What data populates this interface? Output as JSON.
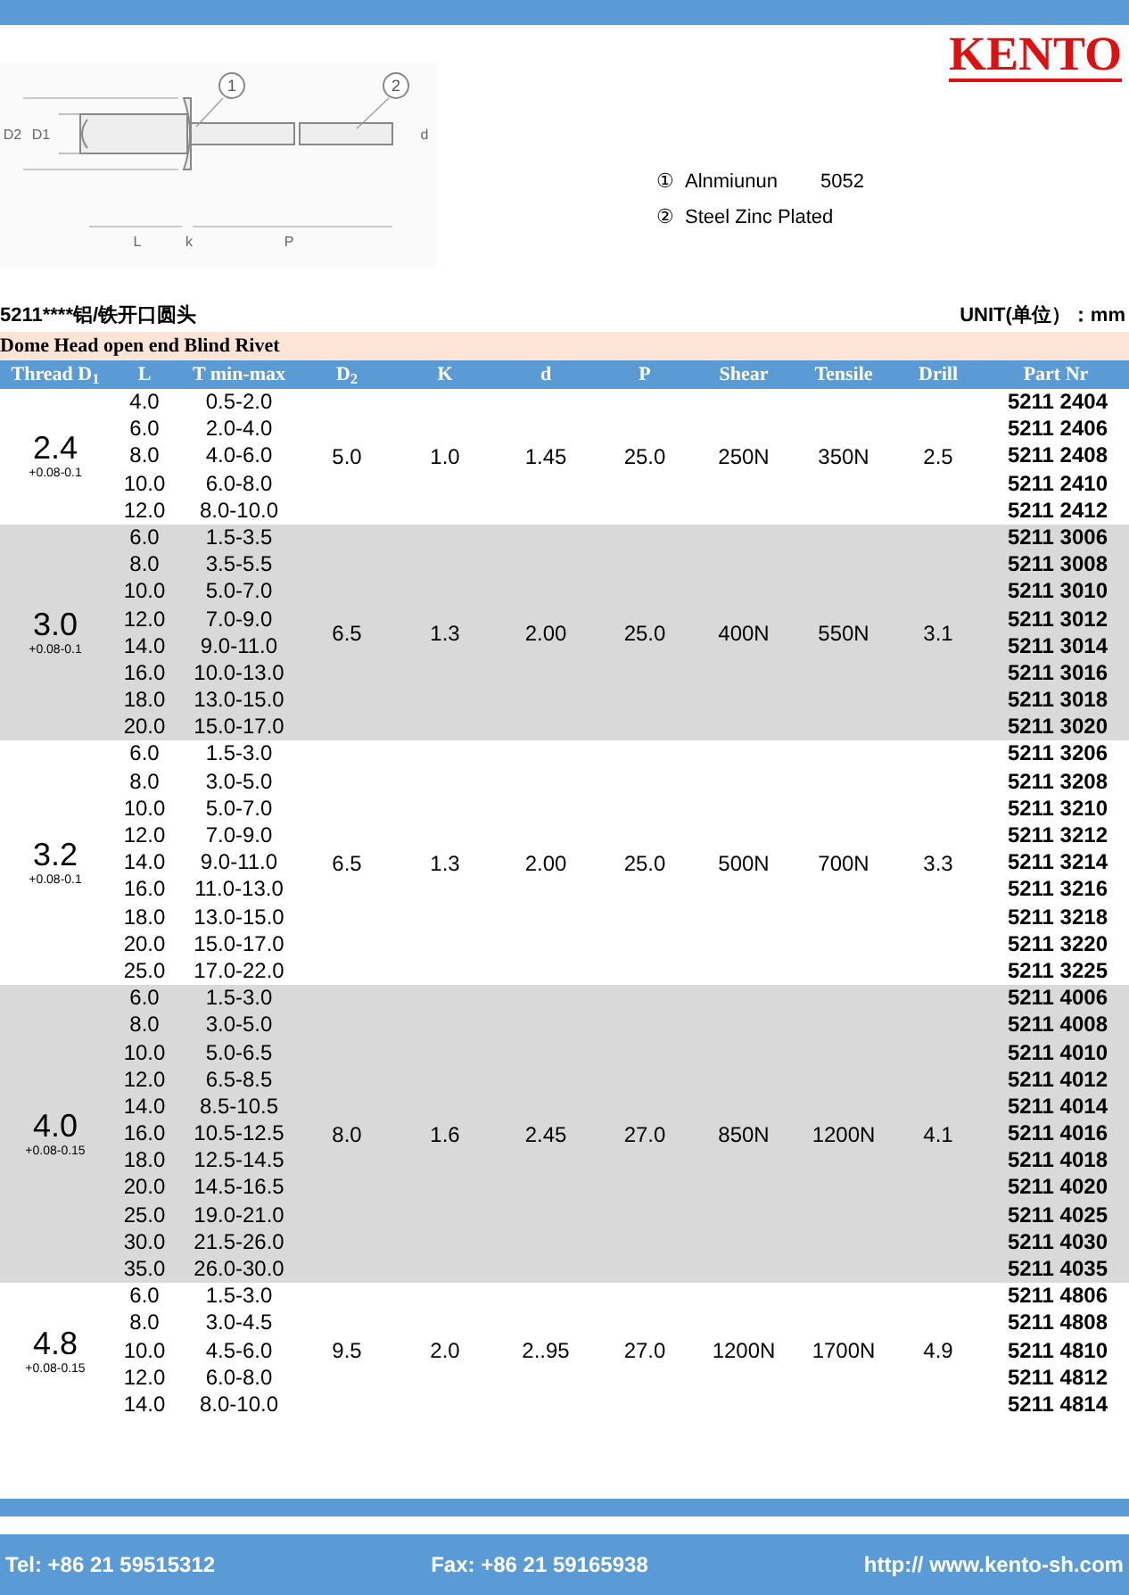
{
  "logo": "KENTO",
  "diagram": {
    "callouts": [
      "1",
      "2"
    ],
    "labels": [
      "D2",
      "D1",
      "d",
      "L",
      "k",
      "P"
    ]
  },
  "legend": [
    {
      "marker": "①",
      "material": "Alnmiunun",
      "grade": "5052"
    },
    {
      "marker": "②",
      "material": "Steel Zinc Plated"
    }
  ],
  "series_name": "5211****铝/铁开口圆头",
  "unit": "UNIT(单位）：mm",
  "table": {
    "title": "Dome Head open end Blind Rivet",
    "columns": [
      "Thread D$_{1}$",
      "L",
      "T min-max",
      "D$_{2}$",
      "K",
      "d",
      "P",
      "Shear",
      "Tensile",
      "Drill",
      "Part Nr"
    ],
    "groups": [
      {
        "shaded": false,
        "thread": "2.4",
        "tolerance": "+0.08-0.1",
        "d2": "5.0",
        "k": "1.0",
        "d": "1.45",
        "p": "25.0",
        "shear": "250N",
        "tensile": "350N",
        "drill": "2.5",
        "rows": [
          {
            "l": "4.0",
            "t": "0.5-2.0",
            "part": "5211 2404"
          },
          {
            "l": "6.0",
            "t": "2.0-4.0",
            "part": "5211 2406"
          },
          {
            "l": "8.0",
            "t": "4.0-6.0",
            "part": "5211 2408"
          },
          {
            "l": "10.0",
            "t": "6.0-8.0",
            "part": "5211 2410"
          },
          {
            "l": "12.0",
            "t": "8.0-10.0",
            "part": "5211 2412"
          }
        ]
      },
      {
        "shaded": true,
        "thread": "3.0",
        "tolerance": "+0.08-0.1",
        "d2": "6.5",
        "k": "1.3",
        "d": "2.00",
        "p": "25.0",
        "shear": "400N",
        "tensile": "550N",
        "drill": "3.1",
        "rows": [
          {
            "l": "6.0",
            "t": "1.5-3.5",
            "part": "5211 3006"
          },
          {
            "l": "8.0",
            "t": "3.5-5.5",
            "part": "5211 3008"
          },
          {
            "l": "10.0",
            "t": "5.0-7.0",
            "part": "5211 3010"
          },
          {
            "l": "12.0",
            "t": "7.0-9.0",
            "part": "5211 3012"
          },
          {
            "l": "14.0",
            "t": "9.0-11.0",
            "part": "5211 3014"
          },
          {
            "l": "16.0",
            "t": "10.0-13.0",
            "part": "5211 3016"
          },
          {
            "l": "18.0",
            "t": "13.0-15.0",
            "part": "5211 3018"
          },
          {
            "l": "20.0",
            "t": "15.0-17.0",
            "part": "5211 3020"
          }
        ]
      },
      {
        "shaded": false,
        "thread": "3.2",
        "tolerance": "+0.08-0.1",
        "d2": "6.5",
        "k": "1.3",
        "d": "2.00",
        "p": "25.0",
        "shear": "500N",
        "tensile": "700N",
        "drill": "3.3",
        "rows": [
          {
            "l": "6.0",
            "t": "1.5-3.0",
            "part": "5211 3206"
          },
          {
            "l": "8.0",
            "t": "3.0-5.0",
            "part": "5211 3208"
          },
          {
            "l": "10.0",
            "t": "5.0-7.0",
            "part": "5211 3210"
          },
          {
            "l": "12.0",
            "t": "7.0-9.0",
            "part": "5211 3212"
          },
          {
            "l": "14.0",
            "t": "9.0-11.0",
            "part": "5211 3214"
          },
          {
            "l": "16.0",
            "t": "11.0-13.0",
            "part": "5211 3216"
          },
          {
            "l": "18.0",
            "t": "13.0-15.0",
            "part": "5211 3218"
          },
          {
            "l": "20.0",
            "t": "15.0-17.0",
            "part": "5211 3220"
          },
          {
            "l": "25.0",
            "t": "17.0-22.0",
            "part": "5211 3225"
          }
        ]
      },
      {
        "shaded": true,
        "thread": "4.0",
        "tolerance": "+0.08-0.15",
        "d2": "8.0",
        "k": "1.6",
        "d": "2.45",
        "p": "27.0",
        "shear": "850N",
        "tensile": "1200N",
        "drill": "4.1",
        "rows": [
          {
            "l": "6.0",
            "t": "1.5-3.0",
            "part": "5211 4006"
          },
          {
            "l": "8.0",
            "t": "3.0-5.0",
            "part": "5211 4008"
          },
          {
            "l": "10.0",
            "t": "5.0-6.5",
            "part": "5211 4010"
          },
          {
            "l": "12.0",
            "t": "6.5-8.5",
            "part": "5211 4012"
          },
          {
            "l": "14.0",
            "t": "8.5-10.5",
            "part": "5211 4014"
          },
          {
            "l": "16.0",
            "t": "10.5-12.5",
            "part": "5211 4016"
          },
          {
            "l": "18.0",
            "t": "12.5-14.5",
            "part": "5211 4018"
          },
          {
            "l": "20.0",
            "t": "14.5-16.5",
            "part": "5211 4020"
          },
          {
            "l": "25.0",
            "t": "19.0-21.0",
            "part": "5211 4025"
          },
          {
            "l": "30.0",
            "t": "21.5-26.0",
            "part": "5211 4030"
          },
          {
            "l": "35.0",
            "t": "26.0-30.0",
            "part": "5211 4035"
          }
        ]
      },
      {
        "shaded": false,
        "thread": "4.8",
        "tolerance": "+0.08-0.15",
        "d2": "9.5",
        "k": "2.0",
        "d": "2..95",
        "p": "27.0",
        "shear": "1200N",
        "tensile": "1700N",
        "drill": "4.9",
        "rows": [
          {
            "l": "6.0",
            "t": "1.5-3.0",
            "part": "5211 4806"
          },
          {
            "l": "8.0",
            "t": "3.0-4.5",
            "part": "5211 4808"
          },
          {
            "l": "10.0",
            "t": "4.5-6.0",
            "part": "5211 4810"
          },
          {
            "l": "12.0",
            "t": "6.0-8.0",
            "part": "5211 4812"
          },
          {
            "l": "14.0",
            "t": "8.0-10.0",
            "part": "5211 4814"
          }
        ]
      }
    ]
  },
  "footer": {
    "tel": "Tel: +86 21 59515312",
    "fax": "Fax: +86 21 59165938",
    "web": "http:// www.kento-sh.com"
  }
}
